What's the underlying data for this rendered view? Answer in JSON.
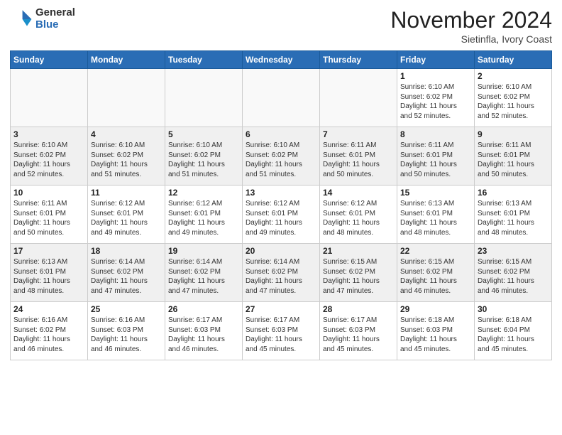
{
  "header": {
    "logo_general": "General",
    "logo_blue": "Blue",
    "month_title": "November 2024",
    "location": "Sietinfla, Ivory Coast"
  },
  "days_of_week": [
    "Sunday",
    "Monday",
    "Tuesday",
    "Wednesday",
    "Thursday",
    "Friday",
    "Saturday"
  ],
  "weeks": [
    [
      {
        "day": "",
        "info": ""
      },
      {
        "day": "",
        "info": ""
      },
      {
        "day": "",
        "info": ""
      },
      {
        "day": "",
        "info": ""
      },
      {
        "day": "",
        "info": ""
      },
      {
        "day": "1",
        "info": "Sunrise: 6:10 AM\nSunset: 6:02 PM\nDaylight: 11 hours\nand 52 minutes."
      },
      {
        "day": "2",
        "info": "Sunrise: 6:10 AM\nSunset: 6:02 PM\nDaylight: 11 hours\nand 52 minutes."
      }
    ],
    [
      {
        "day": "3",
        "info": "Sunrise: 6:10 AM\nSunset: 6:02 PM\nDaylight: 11 hours\nand 52 minutes."
      },
      {
        "day": "4",
        "info": "Sunrise: 6:10 AM\nSunset: 6:02 PM\nDaylight: 11 hours\nand 51 minutes."
      },
      {
        "day": "5",
        "info": "Sunrise: 6:10 AM\nSunset: 6:02 PM\nDaylight: 11 hours\nand 51 minutes."
      },
      {
        "day": "6",
        "info": "Sunrise: 6:10 AM\nSunset: 6:02 PM\nDaylight: 11 hours\nand 51 minutes."
      },
      {
        "day": "7",
        "info": "Sunrise: 6:11 AM\nSunset: 6:01 PM\nDaylight: 11 hours\nand 50 minutes."
      },
      {
        "day": "8",
        "info": "Sunrise: 6:11 AM\nSunset: 6:01 PM\nDaylight: 11 hours\nand 50 minutes."
      },
      {
        "day": "9",
        "info": "Sunrise: 6:11 AM\nSunset: 6:01 PM\nDaylight: 11 hours\nand 50 minutes."
      }
    ],
    [
      {
        "day": "10",
        "info": "Sunrise: 6:11 AM\nSunset: 6:01 PM\nDaylight: 11 hours\nand 50 minutes."
      },
      {
        "day": "11",
        "info": "Sunrise: 6:12 AM\nSunset: 6:01 PM\nDaylight: 11 hours\nand 49 minutes."
      },
      {
        "day": "12",
        "info": "Sunrise: 6:12 AM\nSunset: 6:01 PM\nDaylight: 11 hours\nand 49 minutes."
      },
      {
        "day": "13",
        "info": "Sunrise: 6:12 AM\nSunset: 6:01 PM\nDaylight: 11 hours\nand 49 minutes."
      },
      {
        "day": "14",
        "info": "Sunrise: 6:12 AM\nSunset: 6:01 PM\nDaylight: 11 hours\nand 48 minutes."
      },
      {
        "day": "15",
        "info": "Sunrise: 6:13 AM\nSunset: 6:01 PM\nDaylight: 11 hours\nand 48 minutes."
      },
      {
        "day": "16",
        "info": "Sunrise: 6:13 AM\nSunset: 6:01 PM\nDaylight: 11 hours\nand 48 minutes."
      }
    ],
    [
      {
        "day": "17",
        "info": "Sunrise: 6:13 AM\nSunset: 6:01 PM\nDaylight: 11 hours\nand 48 minutes."
      },
      {
        "day": "18",
        "info": "Sunrise: 6:14 AM\nSunset: 6:02 PM\nDaylight: 11 hours\nand 47 minutes."
      },
      {
        "day": "19",
        "info": "Sunrise: 6:14 AM\nSunset: 6:02 PM\nDaylight: 11 hours\nand 47 minutes."
      },
      {
        "day": "20",
        "info": "Sunrise: 6:14 AM\nSunset: 6:02 PM\nDaylight: 11 hours\nand 47 minutes."
      },
      {
        "day": "21",
        "info": "Sunrise: 6:15 AM\nSunset: 6:02 PM\nDaylight: 11 hours\nand 47 minutes."
      },
      {
        "day": "22",
        "info": "Sunrise: 6:15 AM\nSunset: 6:02 PM\nDaylight: 11 hours\nand 46 minutes."
      },
      {
        "day": "23",
        "info": "Sunrise: 6:15 AM\nSunset: 6:02 PM\nDaylight: 11 hours\nand 46 minutes."
      }
    ],
    [
      {
        "day": "24",
        "info": "Sunrise: 6:16 AM\nSunset: 6:02 PM\nDaylight: 11 hours\nand 46 minutes."
      },
      {
        "day": "25",
        "info": "Sunrise: 6:16 AM\nSunset: 6:03 PM\nDaylight: 11 hours\nand 46 minutes."
      },
      {
        "day": "26",
        "info": "Sunrise: 6:17 AM\nSunset: 6:03 PM\nDaylight: 11 hours\nand 46 minutes."
      },
      {
        "day": "27",
        "info": "Sunrise: 6:17 AM\nSunset: 6:03 PM\nDaylight: 11 hours\nand 45 minutes."
      },
      {
        "day": "28",
        "info": "Sunrise: 6:17 AM\nSunset: 6:03 PM\nDaylight: 11 hours\nand 45 minutes."
      },
      {
        "day": "29",
        "info": "Sunrise: 6:18 AM\nSunset: 6:03 PM\nDaylight: 11 hours\nand 45 minutes."
      },
      {
        "day": "30",
        "info": "Sunrise: 6:18 AM\nSunset: 6:04 PM\nDaylight: 11 hours\nand 45 minutes."
      }
    ]
  ]
}
